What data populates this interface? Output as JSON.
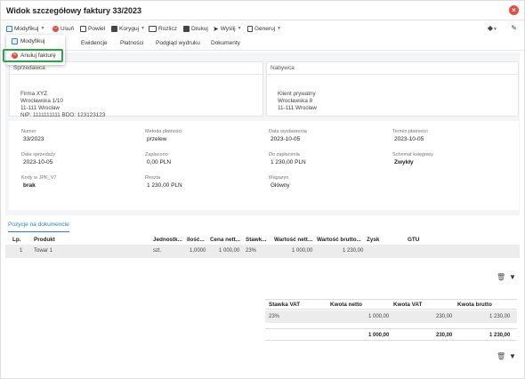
{
  "window": {
    "title": "Widok szczegółowy faktury 33/2023",
    "close_icon": "close-icon"
  },
  "toolbar": {
    "modify": "Modyfikuj",
    "delete": "Usuń",
    "repeat": "Powiel",
    "correct": "Koryguj",
    "settle": "Rozlicz",
    "print": "Drukuj",
    "send": "Wyślij",
    "generate": "Generuj"
  },
  "dropdown": {
    "items": [
      "Modyfikuj",
      "Anuluj fakturę"
    ]
  },
  "tabs": [
    "Dane",
    "Ewidencje",
    "Płatności",
    "Podgląd wydruku",
    "Dokumenty"
  ],
  "seller": {
    "header": "Sprzedawca",
    "lines": [
      "Firma XYZ",
      "Wrocławska 1/10",
      "11-111 Wrocław",
      "NIP: 1111111111 BDO: 123123123"
    ]
  },
  "buyer": {
    "header": "Nabywca",
    "lines": [
      "Klient prywatny",
      "Wrocławska 8",
      "11-111 Wrocław"
    ]
  },
  "info": {
    "number_label": "Numer",
    "number": "33/2023",
    "payment_method_label": "Metoda płatności",
    "payment_method": "przelew",
    "issue_date_label": "Data wystawienia",
    "issue_date": "2023-10-05",
    "due_date_label": "Termin płatności",
    "due_date": "2023-10-05",
    "sale_date_label": "Data sprzedaży",
    "sale_date": "2023-10-05",
    "paid_label": "Zapłacono",
    "paid": "0,00 PLN",
    "to_pay_label": "Do zapłacenia",
    "to_pay": "1 230,00 PLN",
    "scheme_label": "Schemat księgowy",
    "scheme": "Zwykły",
    "jpk_label": "Kody w JPK_V7",
    "jpk": "brak",
    "rest_label": "Reszta",
    "rest": "1 230,00 PLN",
    "warehouse_label": "Magazyn",
    "warehouse": "Główny"
  },
  "positions": {
    "tab_label": "Pozycje na dokumencie",
    "headers": [
      "Lp.",
      "Produkt",
      "Jednostk...",
      "Ilość...",
      "Cena nett...",
      "Stawk...",
      "Wartość nett...",
      "Wartość brutto...",
      "Zysk",
      "GTU"
    ],
    "rows": [
      [
        "1",
        "Towar 1",
        "szt.",
        "1,0000",
        "1 000,00",
        "23%",
        "1 000,00",
        "1 230,00",
        "",
        ""
      ]
    ]
  },
  "vat_table": {
    "headers": [
      "Stawka VAT",
      "Kwota netto",
      "Kwota VAT",
      "Kwota brutto"
    ],
    "rows": [
      [
        "23%",
        "1 000,00",
        "230,00",
        "1 230,00"
      ]
    ],
    "sum": [
      "",
      "1 000,00",
      "230,00",
      "1 230,00"
    ]
  },
  "colors": {
    "accent": "#2f7fd6",
    "danger": "#e74c3c",
    "highlight": "#28a745"
  }
}
